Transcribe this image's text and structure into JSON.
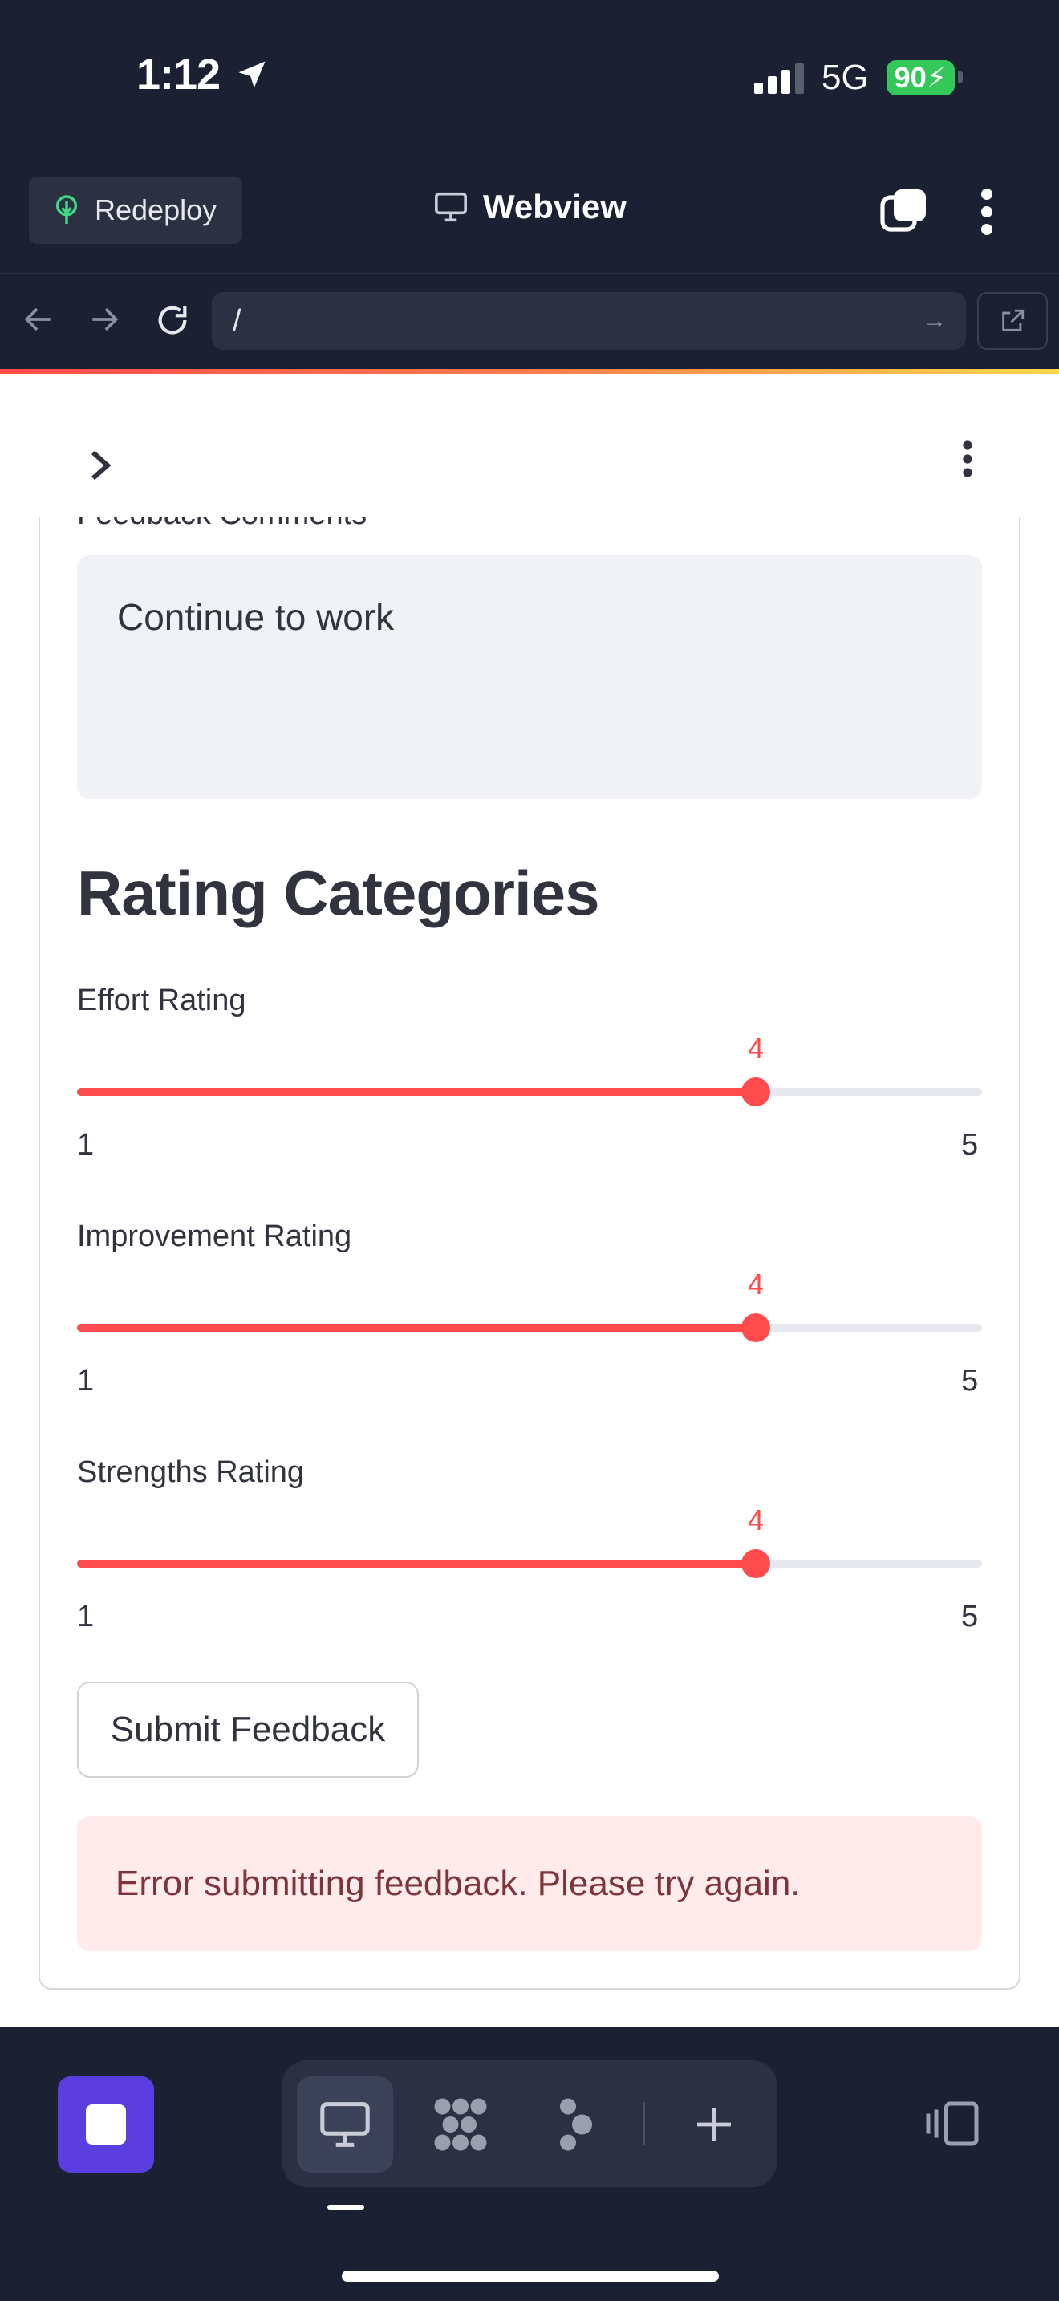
{
  "status_bar": {
    "time": "1:12",
    "network": "5G",
    "battery": "90"
  },
  "toolbar": {
    "redeploy_label": "Redeploy",
    "title": "Webview"
  },
  "address_bar": {
    "url": "/"
  },
  "form": {
    "comments_label": "Feedback Comments",
    "comments_value": "Continue to work",
    "section_heading": "Rating Categories",
    "sliders": [
      {
        "label": "Effort Rating",
        "value": "4",
        "min": "1",
        "max": "5",
        "fraction": 0.75
      },
      {
        "label": "Improvement Rating",
        "value": "4",
        "min": "1",
        "max": "5",
        "fraction": 0.75
      },
      {
        "label": "Strengths Rating",
        "value": "4",
        "min": "1",
        "max": "5",
        "fraction": 0.75
      }
    ],
    "submit_label": "Submit Feedback",
    "error_message": "Error submitting feedback. Please try again."
  },
  "colors": {
    "accent": "#ff4b4b",
    "bg_dark": "#1c2033",
    "error_bg": "#ffebeb",
    "error_text": "#7d353b",
    "stop_button": "#5b3ee0"
  },
  "icons": [
    "location-arrow-icon",
    "signal-icon",
    "battery-icon",
    "tree-icon",
    "monitor-icon",
    "tabs-icon",
    "more-vertical-icon",
    "back-arrow-icon",
    "forward-arrow-icon",
    "reload-icon",
    "external-link-icon",
    "chevron-right-icon",
    "stop-icon",
    "desktop-icon",
    "grid-icon",
    "agent-icon",
    "plus-icon",
    "split-view-icon"
  ]
}
